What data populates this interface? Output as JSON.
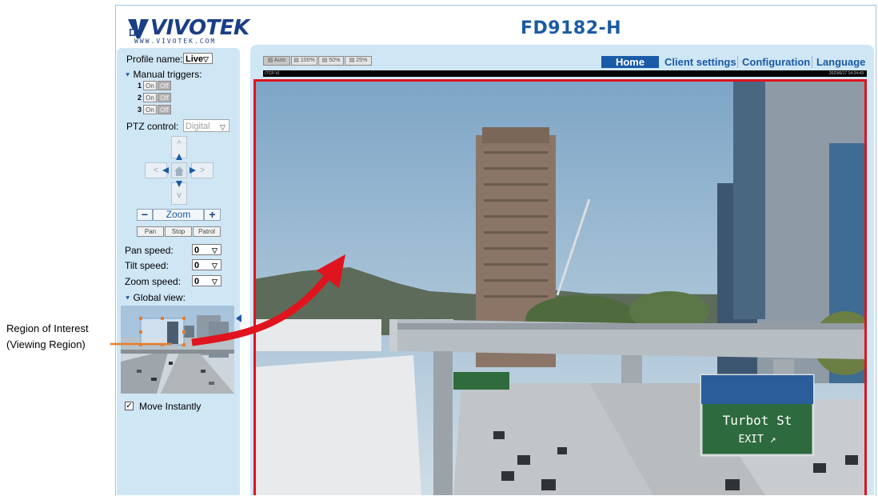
{
  "brand": {
    "logo_text": "VIVOTEK",
    "logo_sub": "WWW.VIVOTEK.COM"
  },
  "camera_model": "FD9182-H",
  "sidebar": {
    "profile_label": "Profile name:",
    "profile_value": "Live",
    "manual_triggers_label": "Manual triggers:",
    "triggers": [
      {
        "num": "1",
        "on": "On",
        "off": "Off"
      },
      {
        "num": "2",
        "on": "On",
        "off": "Off"
      },
      {
        "num": "3",
        "on": "On",
        "off": "Off"
      }
    ],
    "ptz_label": "PTZ control:",
    "ptz_value": "Digital",
    "zoom_label": "Zoom",
    "zoom_minus": "−",
    "zoom_plus": "+",
    "pan_btn": "Pan",
    "stop_btn": "Stop",
    "patrol_btn": "Patrol",
    "pan_speed_label": "Pan speed:",
    "pan_speed_value": "0",
    "tilt_speed_label": "Tilt speed:",
    "tilt_speed_value": "0",
    "zoom_speed_label": "Zoom speed:",
    "zoom_speed_value": "0",
    "global_view_label": "Global view:",
    "move_instantly_label": "Move Instantly",
    "move_instantly_checked": true
  },
  "view_sizes": [
    "Auto",
    "100%",
    "50%",
    "25%"
  ],
  "nav": {
    "home": "Home",
    "client_settings": "Client settings",
    "configuration": "Configuration",
    "language": "Language"
  },
  "status": {
    "left": "(TCP-V)",
    "right": "2023/6/17 14:24:43"
  },
  "video_sign": {
    "line1": "Turbot St",
    "line2": "EXIT ↗"
  },
  "annotation": {
    "line1": "Region of Interest",
    "line2": "(Viewing Region)"
  },
  "colors": {
    "accent": "#1a5aa6",
    "panel": "#cfe6f5",
    "roi_border": "#e0141e"
  }
}
